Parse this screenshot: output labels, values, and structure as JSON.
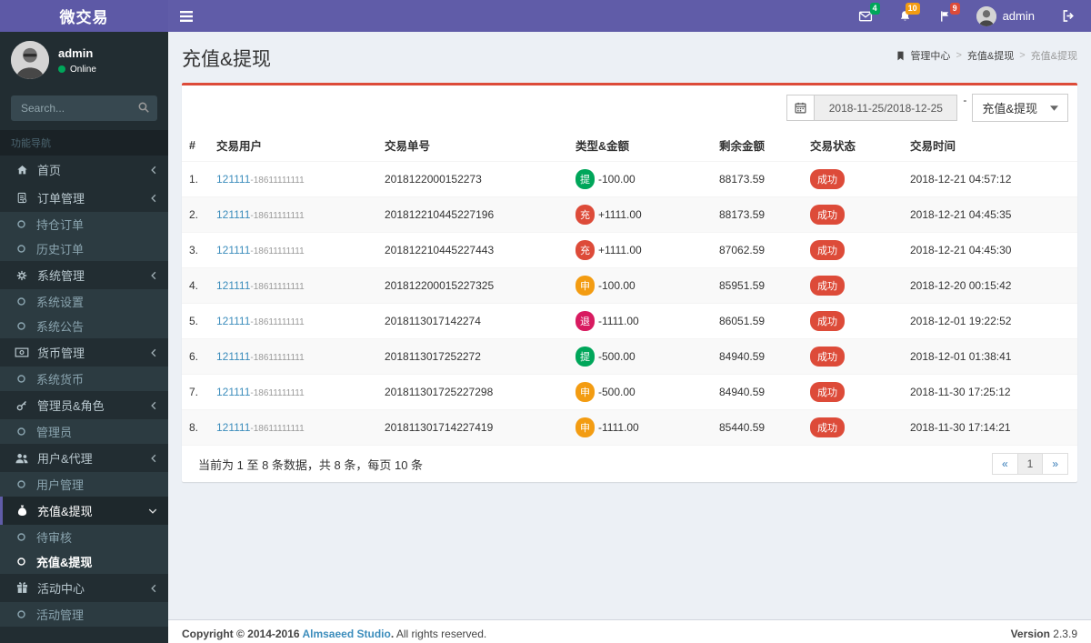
{
  "navbar": {
    "brand": "微交易",
    "notifications": [
      {
        "name": "messages",
        "icon": "envelope-icon",
        "count": "4",
        "badge_color": "#00a65a"
      },
      {
        "name": "notifications",
        "icon": "bell-icon",
        "count": "10",
        "badge_color": "#f39c12"
      },
      {
        "name": "tasks",
        "icon": "flag-icon",
        "count": "9",
        "badge_color": "#dd4b39"
      }
    ],
    "user_name": "admin"
  },
  "sidebar": {
    "user_name": "admin",
    "user_status": "Online",
    "search_placeholder": "Search...",
    "section_label": "功能导航",
    "menu": [
      {
        "name": "home",
        "label": "首页",
        "type": "parent",
        "icon": "home-icon",
        "chevron": "left"
      },
      {
        "name": "order-management",
        "label": "订单管理",
        "type": "parent",
        "icon": "orders-icon",
        "chevron": "left"
      },
      {
        "name": "position-orders",
        "label": "持仓订单",
        "type": "sub"
      },
      {
        "name": "history-orders",
        "label": "历史订单",
        "type": "sub"
      },
      {
        "name": "system-management",
        "label": "系统管理",
        "type": "parent",
        "icon": "gear-icon",
        "chevron": "left"
      },
      {
        "name": "system-settings",
        "label": "系统设置",
        "type": "sub"
      },
      {
        "name": "system-announcement",
        "label": "系统公告",
        "type": "sub"
      },
      {
        "name": "currency-management",
        "label": "货币管理",
        "type": "parent",
        "icon": "money-icon",
        "chevron": "left"
      },
      {
        "name": "system-currency",
        "label": "系统货币",
        "type": "sub"
      },
      {
        "name": "admin-roles",
        "label": "管理员&角色",
        "type": "parent",
        "icon": "key-icon",
        "chevron": "left"
      },
      {
        "name": "admins",
        "label": "管理员",
        "type": "sub"
      },
      {
        "name": "users-agents",
        "label": "用户&代理",
        "type": "parent",
        "icon": "users-icon",
        "chevron": "left"
      },
      {
        "name": "user-management",
        "label": "用户管理",
        "type": "sub"
      },
      {
        "name": "recharge-withdraw",
        "label": "充值&提现",
        "type": "parent",
        "icon": "moneybag-icon",
        "chevron": "down",
        "active": true
      },
      {
        "name": "pending-review",
        "label": "待审核",
        "type": "sub"
      },
      {
        "name": "recharge-withdraw-list",
        "label": "充值&提现",
        "type": "sub",
        "active": true
      },
      {
        "name": "activity-center",
        "label": "活动中心",
        "type": "parent",
        "icon": "gift-icon",
        "chevron": "left"
      },
      {
        "name": "activity-management",
        "label": "活动管理",
        "type": "sub"
      }
    ]
  },
  "content": {
    "page_title": "充值&提现",
    "breadcrumb": [
      "管理中心",
      "充值&提现",
      "充值&提现"
    ],
    "toolbar": {
      "date_range": "2018-11-25/2018-12-25",
      "range_separator": "-",
      "filter_selected": "充值&提现"
    },
    "table": {
      "headers": [
        "#",
        "交易用户",
        "交易单号",
        "类型&金额",
        "剩余金额",
        "交易状态",
        "交易时间"
      ],
      "status_color": "#dd4b39",
      "rows": [
        {
          "index": "1.",
          "user": "121111",
          "user_suffix": "-18611111111",
          "order_no": "2018122000152273",
          "type": "提",
          "type_color": "#00a65a",
          "amount": "-100.00",
          "balance": "88173.59",
          "status": "成功",
          "time": "2018-12-21 04:57:12"
        },
        {
          "index": "2.",
          "user": "121111",
          "user_suffix": "-18611111111",
          "order_no": "201812210445227196",
          "type": "充",
          "type_color": "#dd4b39",
          "amount": "+1111.00",
          "balance": "88173.59",
          "status": "成功",
          "time": "2018-12-21 04:45:35"
        },
        {
          "index": "3.",
          "user": "121111",
          "user_suffix": "-18611111111",
          "order_no": "201812210445227443",
          "type": "充",
          "type_color": "#dd4b39",
          "amount": "+1111.00",
          "balance": "87062.59",
          "status": "成功",
          "time": "2018-12-21 04:45:30"
        },
        {
          "index": "4.",
          "user": "121111",
          "user_suffix": "-18611111111",
          "order_no": "201812200015227325",
          "type": "申",
          "type_color": "#f39c12",
          "amount": "-100.00",
          "balance": "85951.59",
          "status": "成功",
          "time": "2018-12-20 00:15:42"
        },
        {
          "index": "5.",
          "user": "121111",
          "user_suffix": "-18611111111",
          "order_no": "2018113017142274",
          "type": "退",
          "type_color": "#d81b60",
          "amount": "-1111.00",
          "balance": "86051.59",
          "status": "成功",
          "time": "2018-12-01 19:22:52"
        },
        {
          "index": "6.",
          "user": "121111",
          "user_suffix": "-18611111111",
          "order_no": "2018113017252272",
          "type": "提",
          "type_color": "#00a65a",
          "amount": "-500.00",
          "balance": "84940.59",
          "status": "成功",
          "time": "2018-12-01 01:38:41"
        },
        {
          "index": "7.",
          "user": "121111",
          "user_suffix": "-18611111111",
          "order_no": "201811301725227298",
          "type": "申",
          "type_color": "#f39c12",
          "amount": "-500.00",
          "balance": "84940.59",
          "status": "成功",
          "time": "2018-11-30 17:25:12"
        },
        {
          "index": "8.",
          "user": "121111",
          "user_suffix": "-18611111111",
          "order_no": "201811301714227419",
          "type": "申",
          "type_color": "#f39c12",
          "amount": "-1111.00",
          "balance": "85440.59",
          "status": "成功",
          "time": "2018-11-30 17:14:21"
        }
      ],
      "summary": "当前为 1 至 8 条数据，共 8 条，每页 10 条",
      "pagination": {
        "prev": "«",
        "pages": [
          "1"
        ],
        "current": "1",
        "next": "»"
      }
    }
  },
  "footer": {
    "copyright_strong_prefix": "Copyright © 2014-2016 ",
    "link_label": "Almsaeed Studio",
    "copyright_strong_suffix": ".",
    "rights": " All rights reserved.",
    "version_label": "Version",
    "version_value": "2.3.9"
  }
}
